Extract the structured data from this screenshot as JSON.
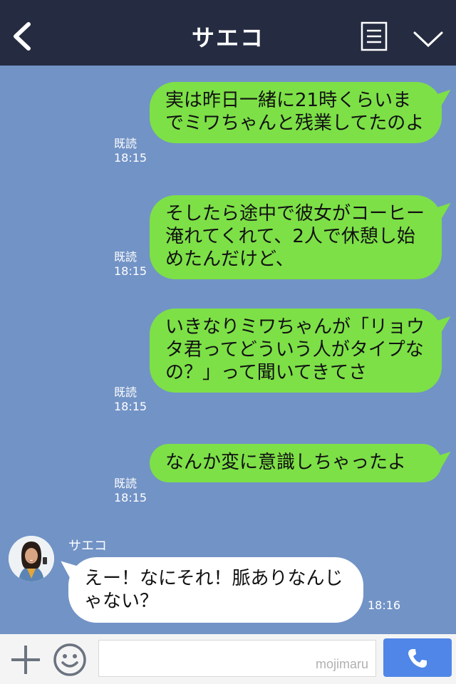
{
  "header": {
    "title": "サエコ"
  },
  "messages_out": [
    {
      "text": "実は昨日一緒に21時くらいまでミワちゃんと残業してたのよ",
      "read": "既読",
      "time": "18:15"
    },
    {
      "text": "そしたら途中で彼女がコーヒー淹れてくれて、2人で休憩し始めたんだけど、",
      "read": "既読",
      "time": "18:15"
    },
    {
      "text": "いきなりミワちゃんが「リョウタ君ってどういう人がタイプなの？」って聞いてきてさ",
      "read": "既読",
      "time": "18:15"
    },
    {
      "text": "なんか変に意識しちゃったよ",
      "read": "既読",
      "time": "18:15"
    }
  ],
  "message_in": {
    "sender": "サエコ",
    "text": "えー！なにそれ！脈ありなんじゃない？",
    "time": "18:16"
  },
  "footer": {
    "watermark": "mojimaru"
  },
  "colors": {
    "header_bg": "#252c41",
    "chat_bg": "#7293c6",
    "bubble_out": "#7de047",
    "bubble_in": "#ffffff",
    "call_button": "#4f86e8"
  }
}
